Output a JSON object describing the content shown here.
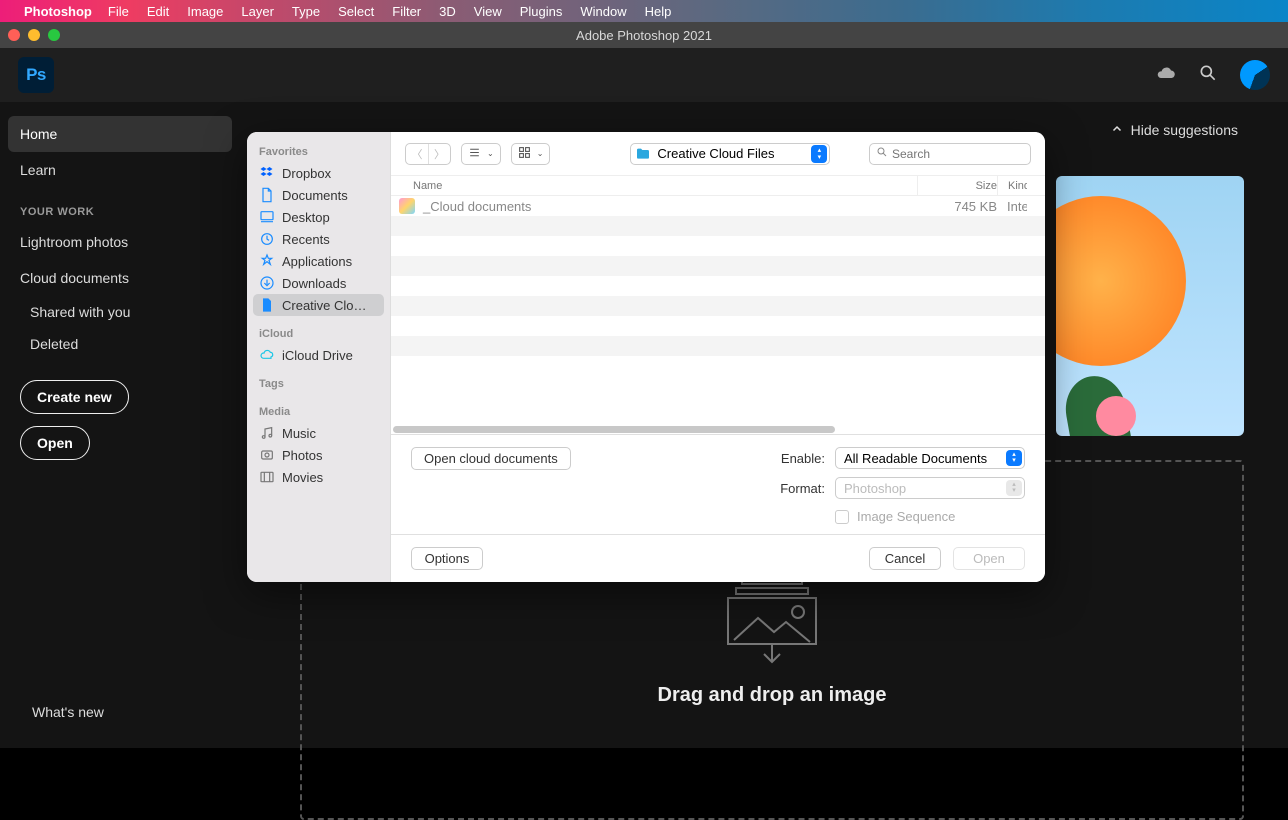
{
  "menubar": {
    "app": "Photoshop",
    "items": [
      "File",
      "Edit",
      "Image",
      "Layer",
      "Type",
      "Select",
      "Filter",
      "3D",
      "View",
      "Plugins",
      "Window",
      "Help"
    ]
  },
  "window": {
    "title": "Adobe Photoshop 2021"
  },
  "logo": "Ps",
  "sidebar": {
    "home": "Home",
    "learn": "Learn",
    "your_work": "YOUR WORK",
    "lightroom": "Lightroom photos",
    "cloud_docs": "Cloud documents",
    "shared": "Shared with you",
    "deleted": "Deleted",
    "create_new": "Create new",
    "open": "Open",
    "whats_new": "What's new"
  },
  "main": {
    "hide_suggestions": "Hide suggestions",
    "drop_title": "Drag and drop an image"
  },
  "dialog": {
    "favorites_label": "Favorites",
    "icloud_label": "iCloud",
    "tags_label": "Tags",
    "media_label": "Media",
    "fav": {
      "dropbox": "Dropbox",
      "documents": "Documents",
      "desktop": "Desktop",
      "recents": "Recents",
      "applications": "Applications",
      "downloads": "Downloads",
      "ccf": "Creative Clo…"
    },
    "icloud_drive": "iCloud Drive",
    "media": {
      "music": "Music",
      "photos": "Photos",
      "movies": "Movies"
    },
    "path_label": "Creative Cloud Files",
    "search_placeholder": "Search",
    "cols": {
      "name": "Name",
      "size": "Size",
      "kind": "Kind"
    },
    "file": {
      "name": "_Cloud documents",
      "size": "745 KB",
      "kind": "Inte"
    },
    "open_cloud": "Open cloud documents",
    "enable_label": "Enable:",
    "format_label": "Format:",
    "enable_value": "All Readable Documents",
    "format_value": "Photoshop",
    "image_sequence": "Image Sequence",
    "options": "Options",
    "cancel": "Cancel",
    "open": "Open"
  }
}
